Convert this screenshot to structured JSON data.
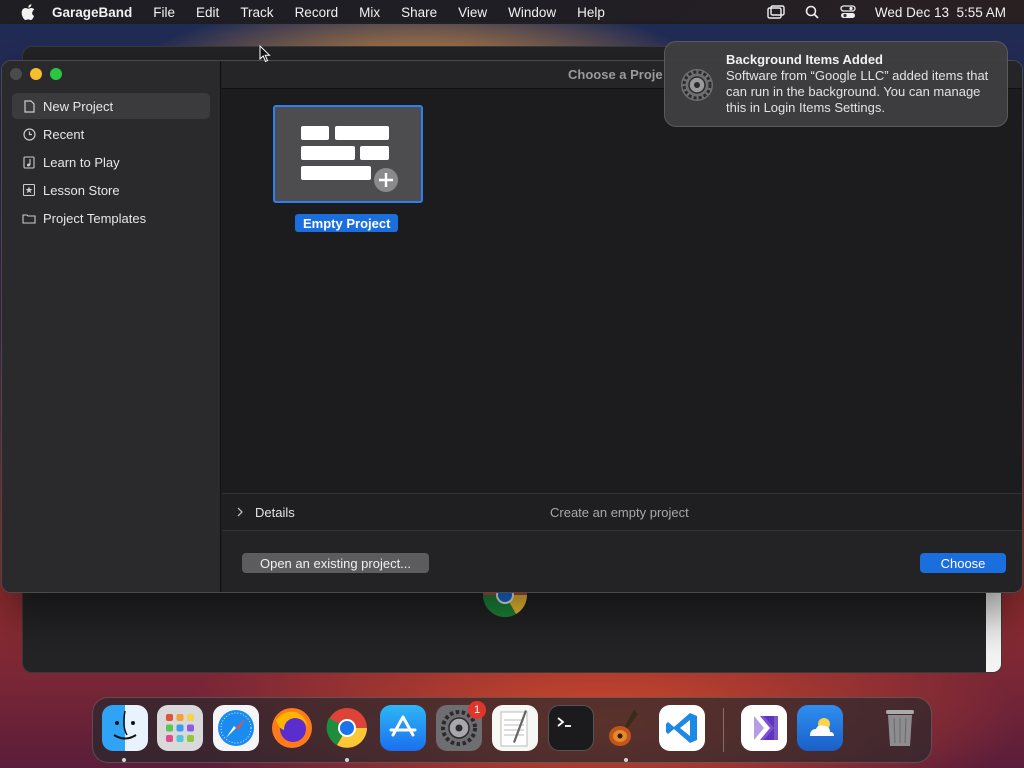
{
  "menubar": {
    "app": "GarageBand",
    "items": [
      "File",
      "Edit",
      "Track",
      "Record",
      "Mix",
      "Share",
      "View",
      "Window",
      "Help"
    ],
    "datetime": "Wed Dec 13  5:55 AM"
  },
  "window": {
    "title": "Choose a Proje",
    "sidebar": [
      {
        "label": "New Project",
        "icon": "document-icon",
        "selected": true
      },
      {
        "label": "Recent",
        "icon": "clock-icon"
      },
      {
        "label": "Learn to Play",
        "icon": "music-note-icon"
      },
      {
        "label": "Lesson Store",
        "icon": "star-icon"
      },
      {
        "label": "Project Templates",
        "icon": "folder-icon"
      }
    ],
    "tile_label": "Empty Project",
    "details_label": "Details",
    "details_desc": "Create an empty project",
    "open_button": "Open an existing project...",
    "choose_button": "Choose"
  },
  "notification": {
    "title": "Background Items Added",
    "body": "Software from “Google LLC” added items that can run in the background. You can manage this in Login Items Settings."
  },
  "dock": {
    "items": [
      "Finder",
      "Launchpad",
      "Safari",
      "Firefox",
      "Chrome",
      "App Store",
      "System Settings",
      "TextEdit",
      "Terminal",
      "GarageBand",
      "Visual Studio Code",
      "Visual Studio",
      "Weather",
      "Trash"
    ],
    "settings_badge": "1"
  }
}
